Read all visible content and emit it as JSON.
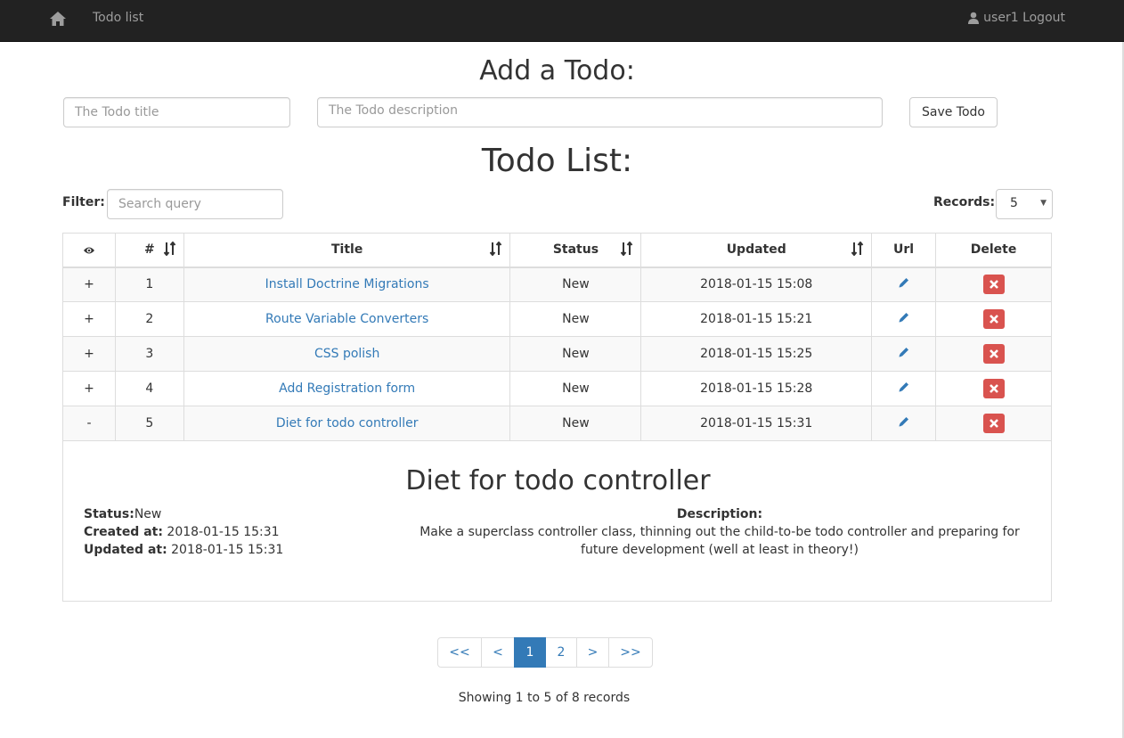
{
  "navbar": {
    "title": "Todo list",
    "user_link": "user1 Logout"
  },
  "add_form": {
    "heading": "Add a Todo:",
    "title_placeholder": "The Todo title",
    "description_placeholder": "The Todo description",
    "save_label": "Save Todo"
  },
  "list": {
    "heading": "Todo List:",
    "filter_label": "Filter:",
    "filter_placeholder": "Search query",
    "records_label": "Records:",
    "records_value": "5",
    "columns": {
      "view": "",
      "num": "#",
      "title": "Title",
      "status": "Status",
      "updated": "Updated",
      "url": "Url",
      "delete": "Delete"
    },
    "rows": [
      {
        "toggle": "+",
        "num": "1",
        "title": "Install Doctrine Migrations",
        "status": "New",
        "updated": "2018-01-15 15:08"
      },
      {
        "toggle": "+",
        "num": "2",
        "title": "Route Variable Converters",
        "status": "New",
        "updated": "2018-01-15 15:21"
      },
      {
        "toggle": "+",
        "num": "3",
        "title": "CSS polish",
        "status": "New",
        "updated": "2018-01-15 15:25"
      },
      {
        "toggle": "+",
        "num": "4",
        "title": "Add Registration form",
        "status": "New",
        "updated": "2018-01-15 15:28"
      },
      {
        "toggle": "-",
        "num": "5",
        "title": "Diet for todo controller",
        "status": "New",
        "updated": "2018-01-15 15:31"
      }
    ]
  },
  "detail": {
    "title": "Diet for todo controller",
    "status_label": "Status:",
    "status_value": "New",
    "created_label": "Created at:",
    "created_value": "2018-01-15 15:31",
    "updated_label": "Updated at:",
    "updated_value": "2018-01-15 15:31",
    "description_label": "Description:",
    "description_text": "Make a superclass controller class, thinning out the child-to-be todo controller and preparing for future development (well at least in theory!)"
  },
  "pagination": {
    "first": "<<",
    "prev": "<",
    "pages": [
      "1",
      "2"
    ],
    "active_page": "1",
    "next": ">",
    "last": ">>",
    "summary": "Showing 1 to 5 of 8 records"
  },
  "colors": {
    "navbar_bg": "#222222",
    "link": "#337ab7",
    "danger": "#d9534f",
    "active_page": "#337ab7"
  },
  "icons": {
    "home": "home-icon",
    "user": "user-icon",
    "eye": "eye-icon",
    "sort": "sort-icon",
    "edit": "pencil-icon",
    "delete": "remove-icon"
  }
}
